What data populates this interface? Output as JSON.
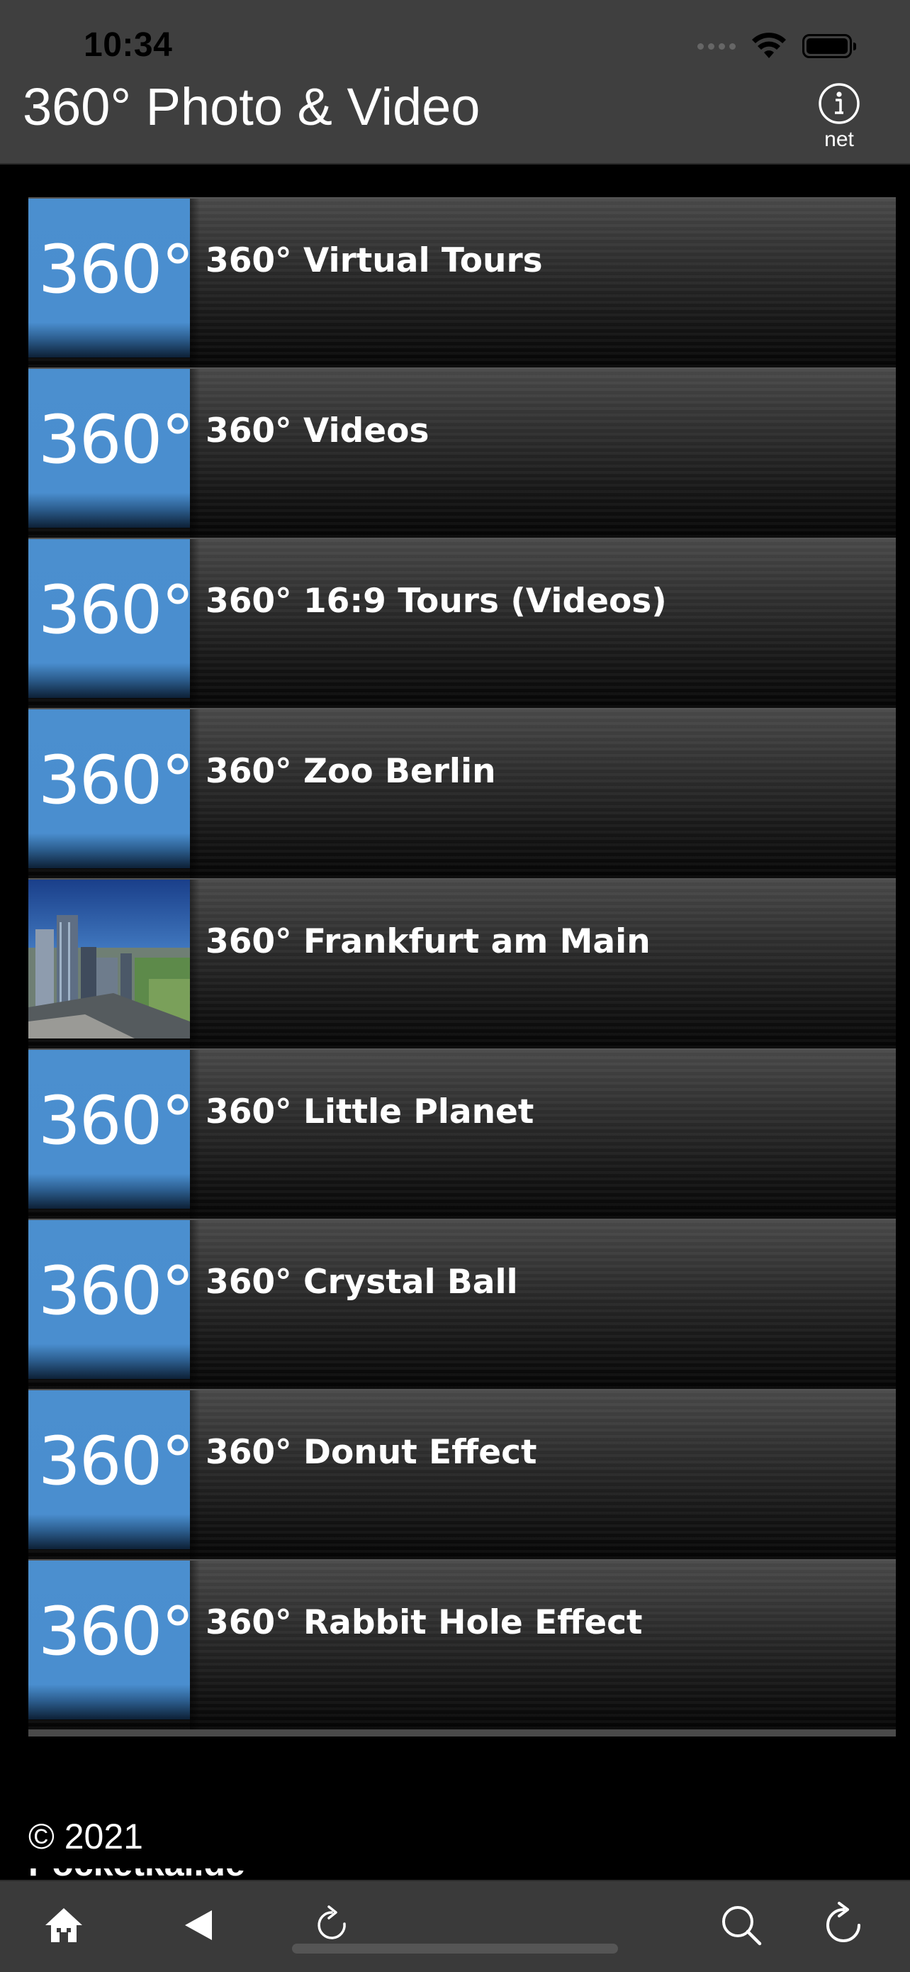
{
  "status_bar": {
    "time": "10:34"
  },
  "header": {
    "title": "360° Photo & Video",
    "info_caption": "net"
  },
  "thumb_text": "360°",
  "menu": {
    "items": [
      {
        "label": "360° Virtual Tours",
        "thumb": "360-badge"
      },
      {
        "label": "360° Videos",
        "thumb": "360-badge"
      },
      {
        "label": "360° 16:9 Tours (Videos)",
        "thumb": "360-badge"
      },
      {
        "label": "360° Zoo Berlin",
        "thumb": "360-badge"
      },
      {
        "label": "360° Frankfurt am Main",
        "thumb": "city-photo"
      },
      {
        "label": "360° Little Planet",
        "thumb": "360-badge"
      },
      {
        "label": "360° Crystal Ball",
        "thumb": "360-badge"
      },
      {
        "label": "360° Donut Effect",
        "thumb": "360-badge"
      },
      {
        "label": "360° Rabbit Hole Effect",
        "thumb": "360-badge"
      }
    ]
  },
  "footer": {
    "copyright": "© 2021",
    "brand": "Pocketkai.de"
  },
  "toolbar": {
    "icons": [
      "home-icon",
      "back-icon",
      "redo-icon",
      "search-icon",
      "reload-icon"
    ]
  },
  "colors": {
    "header_bg": "#3f3f3f",
    "thumb_blue": "#4a8ecf",
    "toolbar_bg": "#3a3a3a"
  }
}
